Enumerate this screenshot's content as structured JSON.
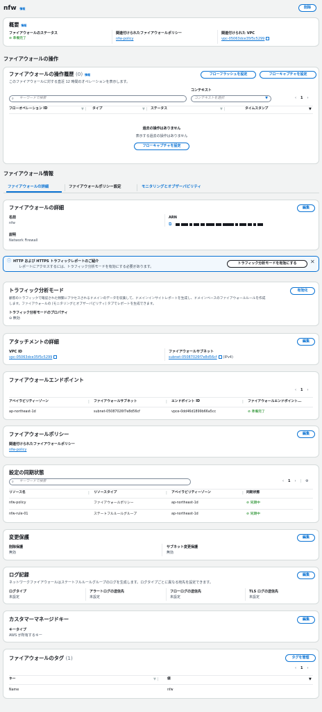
{
  "header": {
    "title": "nfw",
    "info": "情報",
    "delete": "削除"
  },
  "overview": {
    "title": "概要",
    "info": "情報",
    "status_label": "ファイアウォールのステータス",
    "status_value": "準備完了",
    "policy_label": "関連付けられたファイアウォールポリシー",
    "policy_value": "nfw-policy",
    "vpc_label": "関連付けられた VPC",
    "vpc_value": "vpc-05063dce35f5c5299"
  },
  "ops_section": "ファイアウォールの操作",
  "ops": {
    "title": "ファイアウォールの操作履歴",
    "count": "(0)",
    "info": "情報",
    "desc": "このファイアウォールに対する直近 12 時間のオペレーションを表示します。",
    "btn_flush": "フローフラッシュを設定",
    "btn_capture": "フローキャプチャを設定",
    "search_ph": "キーワードで検索",
    "context_label": "コンテキスト",
    "context_ph": "コンテキストを選択",
    "page": "1",
    "cols": [
      "フローオペレーション ID",
      "タイプ",
      "ステータス",
      "タイムスタンプ"
    ],
    "empty_title": "過去の操作はありません",
    "empty_desc": "表示する過去の操作はありません",
    "empty_btn": "フローキャプチャを設定"
  },
  "info_section": "ファイアウォール情報",
  "tabs": [
    "ファイアウォールの詳細",
    "ファイアウォールポリシー設定",
    "モニタリングとオブザーバビリティ"
  ],
  "details": {
    "title": "ファイアウォールの詳細",
    "edit": "編集",
    "name_label": "名前",
    "name_value": "nfw",
    "arn_label": "ARN",
    "desc_label": "説明",
    "desc_value": "Network Firewall"
  },
  "alert": {
    "title": "HTTP および HTTPS トラフィックレポートのご紹介",
    "text": "レポートにアクセスするには、トラフィック分析モードを有効にする必要があります。",
    "btn": "トラフィック分析モードを有効にする"
  },
  "traffic": {
    "title": "トラフィック分析モード",
    "btn": "有効化",
    "desc1": "顧客のトラフィックで確認された頻繁にアクセスされるドメインのデータを収集して、ドメインインサイトレポートを生成し、ドメインベースのファイアウォールルールを作成",
    "desc2": "します。ファイアウォールの [モニタリングとオブザーバビリティ] タブでレポートを生成できます。",
    "prop_label": "トラフィック分析モードのプロパティ",
    "prop_value": "無効"
  },
  "attach": {
    "title": "アタッチメントの詳細",
    "edit": "編集",
    "vpc_label": "VPC ID",
    "vpc_value": "vpc-05063dce35f5c5299",
    "subnet_label": "ファイアウォールサブネット",
    "subnet_value": "subnet-05087026f7e8d56cf",
    "subnet_suffix": "(IPv4)"
  },
  "endpoints": {
    "title": "ファイアウォールエンドポイント",
    "page": "1",
    "cols": [
      "アベイラビリティーゾーン",
      "ファイアウォールサブネット",
      "エンドポイント ID",
      "ファイアウォールエンドポイント..."
    ],
    "rows": [
      [
        "ap-northeast-1d",
        "subnet-05087026f7e8d56cf",
        "vpce-0dd46d1899b66a5cc",
        "準備完了"
      ]
    ]
  },
  "policy": {
    "title": "ファイアウォールポリシー",
    "edit": "編集",
    "label": "関連付けられたファイアウォールポリシー",
    "value": "nfw-policy"
  },
  "sync": {
    "title": "設定の同期状態",
    "search_ph": "キーワードで検索",
    "page": "1",
    "cols": [
      "リソース名",
      "リソースタイプ",
      "アベイラビリティーゾーン",
      "同期状態"
    ],
    "rows": [
      [
        "nfw-policy",
        "ファイアウォールポリシー",
        "ap-northeast-1d",
        "同期中"
      ],
      [
        "nfw-rule-01",
        "ステートフルルールグループ",
        "ap-northeast-1d",
        "同期中"
      ]
    ]
  },
  "protect": {
    "title": "変更保護",
    "edit": "編集",
    "del_label": "削除保護",
    "del_value": "無効",
    "sub_label": "サブネット変更保護",
    "sub_value": "無効"
  },
  "logging": {
    "title": "ログ記録",
    "edit": "編集",
    "desc": "ネットワークファイアウォールはステートフルルールグループのログを生成します。ログタイプごとに異なる宛先を設定できます。",
    "cols": [
      "ログタイプ",
      "アラートログの送信先",
      "フローログの送信先",
      "TLS ログの送信先"
    ],
    "vals": [
      "未設定",
      "未設定",
      "未設定",
      "未設定"
    ]
  },
  "kms": {
    "title": "カスタマーマネージドキー",
    "edit": "編集",
    "label": "キータイプ",
    "value": "AWS が所有するキー"
  },
  "tags": {
    "title": "ファイアウォールのタグ",
    "count": "(1)",
    "btn": "タグを管理",
    "page": "1",
    "cols": [
      "キー",
      "値"
    ],
    "rows": [
      [
        "Name",
        "nfw"
      ]
    ]
  }
}
